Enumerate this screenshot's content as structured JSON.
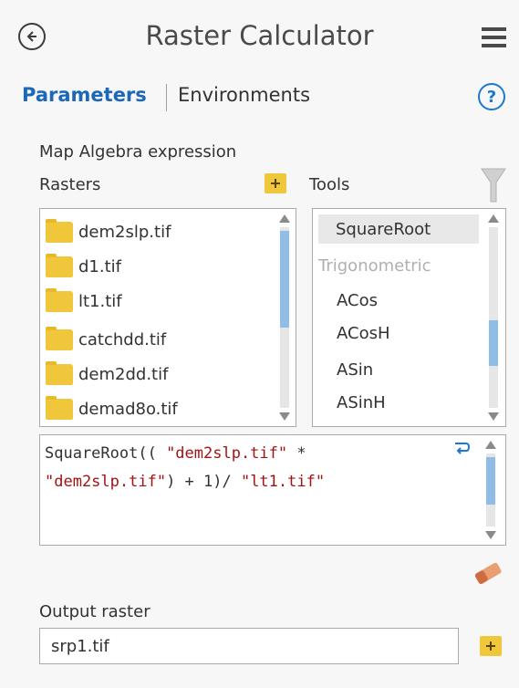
{
  "header": {
    "title": "Raster Calculator",
    "back_icon": "arrow-left-circle-icon",
    "menu_icon": "hamburger-menu-icon"
  },
  "tabs": {
    "parameters": "Parameters",
    "environments": "Environments",
    "help_glyph": "?"
  },
  "section_label": "Map Algebra expression",
  "rasters": {
    "label": "Rasters",
    "items": [
      "dem2slp.tif",
      "d1.tif",
      "lt1.tif",
      "catchdd.tif",
      "dem2dd.tif",
      "demad8o.tif"
    ]
  },
  "tools": {
    "label": "Tools",
    "selected": "SquareRoot",
    "category": "Trigonometric",
    "items": [
      "ACos",
      "ACosH",
      "ASin",
      "ASinH"
    ]
  },
  "expression": {
    "line1_func": "SquareRoot(( ",
    "line1_str": "\"dem2slp.tif\"",
    "line1_op": " *",
    "line2_str1": "\"dem2slp.tif\"",
    "line2_op": ") + 1)/ ",
    "line2_str2": "\"lt1.tif\""
  },
  "output": {
    "label": "Output raster",
    "value": "srp1.tif"
  },
  "colors": {
    "accent": "#1c68b7",
    "folder": "#f0c63a",
    "string_literal": "#a01414",
    "scroll_thumb": "#8fbde6"
  }
}
